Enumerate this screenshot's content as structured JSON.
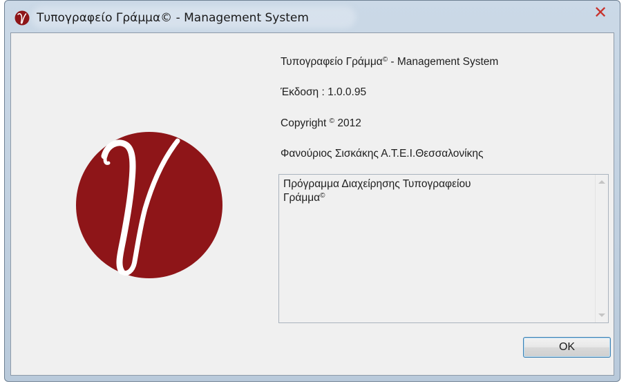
{
  "window": {
    "title": "Τυπογραφείο Γράμμα© - Management System",
    "close_glyph": "✕",
    "title_icon": "app-logo-icon",
    "accent_color": "#8e1518"
  },
  "about": {
    "product_name": "Τυπογραφείο Γράμμα",
    "product_name_mark": "©",
    "product_name_suffix": " - Management System",
    "version": "Έκδοση : 1.0.0.95",
    "copyright_label": "Copyright",
    "copyright_mark": "©",
    "copyright_year": "2012",
    "company": "Φανούριος Σισκάκης Α.Τ.Ε.Ι.Θεσσαλονίκης",
    "description_line1": "Πρόγραμμα Διαχείρησης Τυπογραφείου",
    "description_line2": "Γράμμα",
    "description_mark": "©"
  },
  "buttons": {
    "ok_label": "OK"
  }
}
